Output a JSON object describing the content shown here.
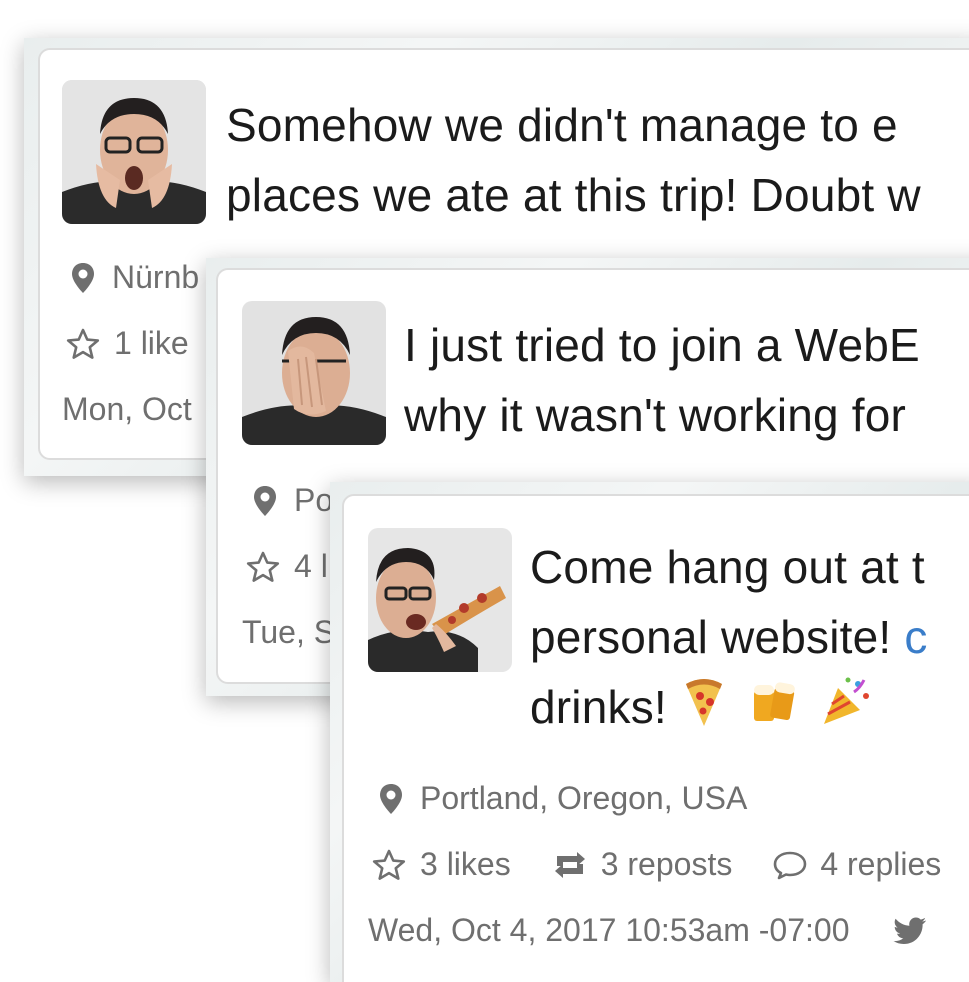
{
  "posts": [
    {
      "text_line1": "Somehow we didn't manage to e",
      "text_line2": "places we ate at this trip! Doubt w",
      "location": "Nürnb",
      "likes": "1 like",
      "date": "Mon, Oct"
    },
    {
      "text_line1": "I just tried to join a WebE",
      "text_line2": "why it wasn't working for",
      "location": "Po",
      "likes": "4 l",
      "date": "Tue, S"
    },
    {
      "text_line1": "Come hang out at t",
      "text_line2_prefix": "personal website! ",
      "text_line2_link": "c",
      "text_line3": "drinks! ",
      "location": "Portland, Oregon, USA",
      "likes": "3 likes",
      "reposts": "3 reposts",
      "replies": "4 replies",
      "date": "Wed, Oct 4, 2017 10:53am -07:00"
    }
  ],
  "icons": [
    "map-pin-icon",
    "star-icon",
    "repost-icon",
    "reply-bubble-icon",
    "twitter-icon",
    "pizza-emoji",
    "beer-emoji",
    "party-popper-emoji"
  ],
  "colors": {
    "text": "#1b1b1b",
    "meta": "#6f6f6f",
    "link": "#3a7dc9",
    "card_border": "#dcdcdc"
  }
}
